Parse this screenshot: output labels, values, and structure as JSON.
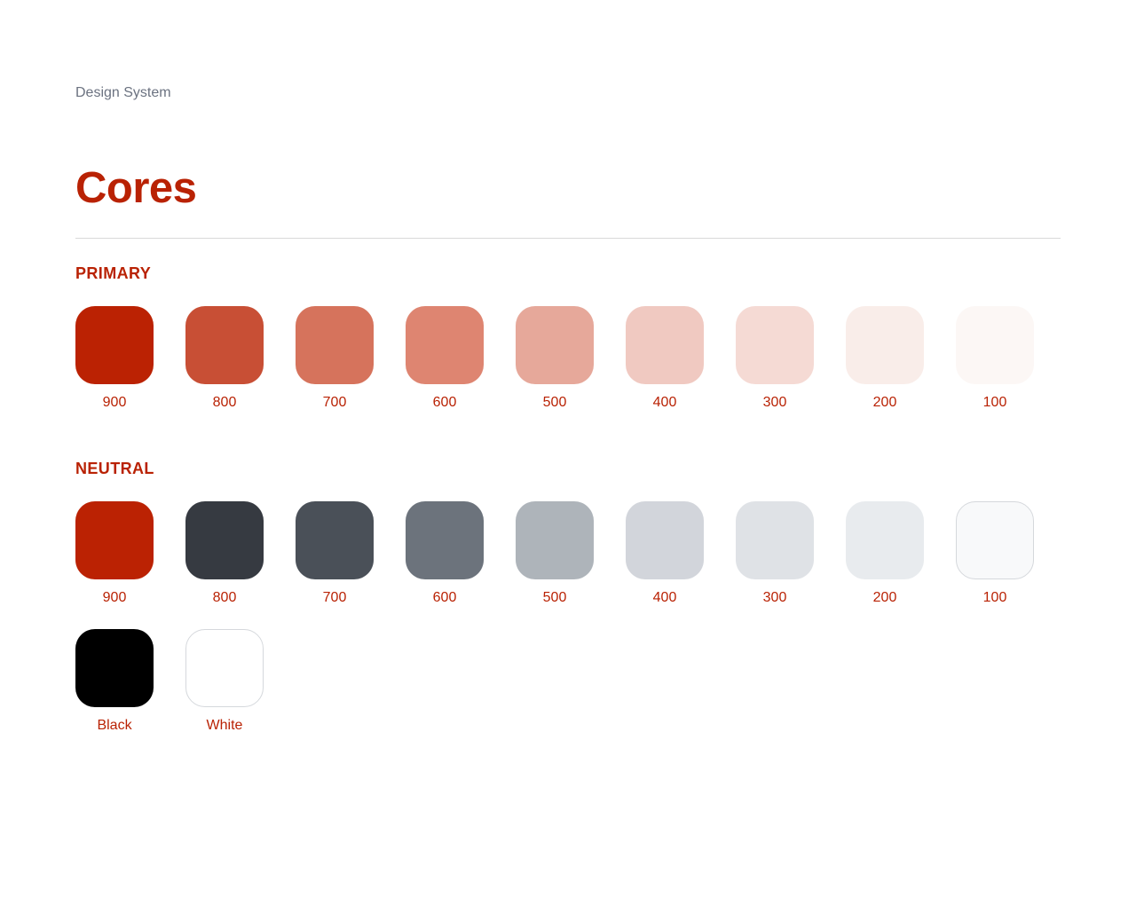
{
  "header": {
    "eyebrow": "Design System",
    "title": "Cores"
  },
  "colors": {
    "accent": "#B92204"
  },
  "primary": {
    "label": "PRIMARY",
    "swatches": [
      {
        "name": "900",
        "color": "#BB2203"
      },
      {
        "name": "800",
        "color": "#C84F35"
      },
      {
        "name": "700",
        "color": "#D6735C"
      },
      {
        "name": "600",
        "color": "#DE8571"
      },
      {
        "name": "500",
        "color": "#E6A89A"
      },
      {
        "name": "400",
        "color": "#F0C9C1"
      },
      {
        "name": "300",
        "color": "#F5DAD4"
      },
      {
        "name": "200",
        "color": "#F9EDE9"
      },
      {
        "name": "100",
        "color": "#FCF7F5"
      }
    ]
  },
  "neutral": {
    "label": "NEUTRAL",
    "swatches": [
      {
        "name": "900",
        "color": "#BB2203"
      },
      {
        "name": "800",
        "color": "#363A41"
      },
      {
        "name": "700",
        "color": "#4A5058"
      },
      {
        "name": "600",
        "color": "#6C737C"
      },
      {
        "name": "500",
        "color": "#AEB4BA"
      },
      {
        "name": "400",
        "color": "#D2D5DB"
      },
      {
        "name": "300",
        "color": "#DFE2E6"
      },
      {
        "name": "200",
        "color": "#E8EBEE"
      },
      {
        "name": "100",
        "color": "#F8F9FA"
      }
    ],
    "extras": [
      {
        "name": "Black",
        "color": "#000000"
      },
      {
        "name": "White",
        "color": "#FFFFFF"
      }
    ]
  }
}
